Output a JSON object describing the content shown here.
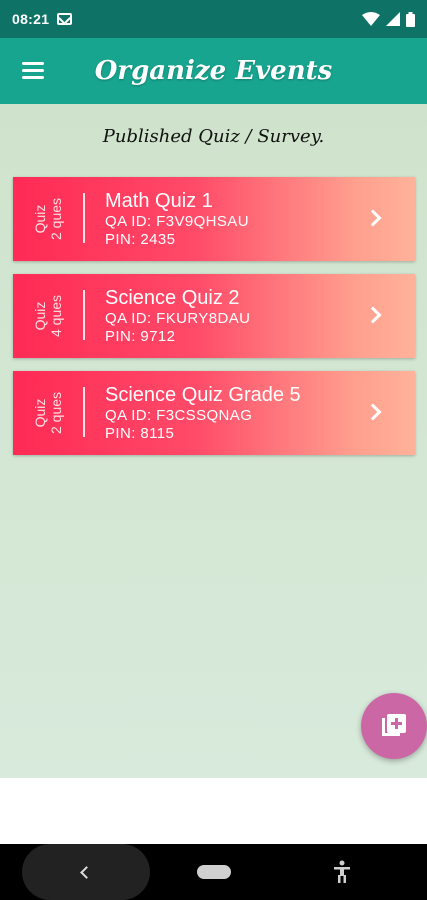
{
  "status_bar": {
    "time": "08:21",
    "icons": [
      "mail-icon",
      "wifi-icon",
      "signal-icon",
      "battery-icon"
    ]
  },
  "app_bar": {
    "title": "Organize Events",
    "menu_icon": "menu-icon"
  },
  "section_title": "Published Quiz / Survey.",
  "quizzes": [
    {
      "type": "Quiz",
      "count": "2 ques",
      "title": "Math Quiz 1",
      "qa_id": "QA ID: F3V9QHSAU",
      "pin": "PIN: 2435"
    },
    {
      "type": "Quiz",
      "count": "4 ques",
      "title": "Science Quiz 2",
      "qa_id": "QA ID: FKURY8DAU",
      "pin": "PIN: 9712"
    },
    {
      "type": "Quiz",
      "count": "2 ques",
      "title": "Science Quiz Grade 5",
      "qa_id": "QA ID: F3CSSQNAG",
      "pin": "PIN: 8115"
    }
  ],
  "fab": {
    "icon": "add-to-library-icon"
  },
  "nav_bar": {
    "icons": [
      "back-icon",
      "home-icon",
      "accessibility-icon"
    ]
  },
  "colors": {
    "status_bar": "#0e7366",
    "app_bar": "#17a58f",
    "card_start": "#ff2a55",
    "card_end": "#ffb29a",
    "fab": "#cc67a6",
    "background": "#cfe3cc"
  }
}
